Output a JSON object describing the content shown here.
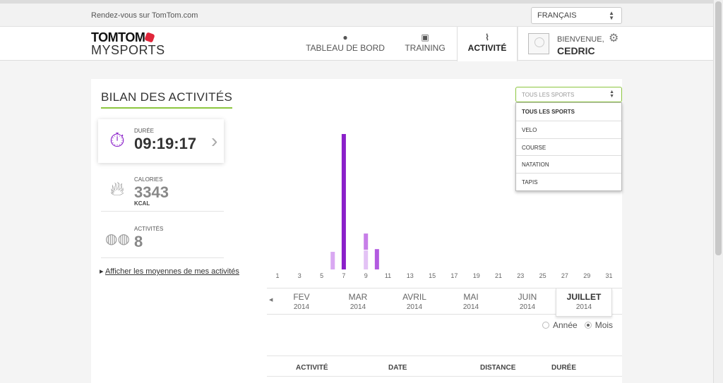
{
  "topbar": {
    "link": "Rendez-vous sur TomTom.com",
    "language": "FRANÇAIS"
  },
  "logo": {
    "line1": "TOMTOM",
    "line2": "MYSPORTS"
  },
  "nav": {
    "dashboard": "TABLEAU DE BORD",
    "training": "TRAINING",
    "activity": "ACTIVITÉ"
  },
  "user": {
    "welcome": "BIENVENUE,",
    "name": "CEDRIC"
  },
  "page": {
    "title": "BILAN DES ACTIVITÉS"
  },
  "stats": {
    "duration": {
      "label": "DURÉE",
      "value": "09:19:17"
    },
    "calories": {
      "label": "CALORIES",
      "value": "3343",
      "unit": "KCAL"
    },
    "activities": {
      "label": "ACTIVITÉS",
      "value": "8"
    }
  },
  "averages_link": "Afficher les moyennes de mes activités",
  "sport_filter": {
    "selected": "TOUS LES SPORTS",
    "options": [
      "TOUS LES SPORTS",
      "VELO",
      "COURSE",
      "NATATION",
      "TAPIS"
    ]
  },
  "chart_data": {
    "type": "bar",
    "x_tick_labels": [
      "1",
      "3",
      "5",
      "7",
      "9",
      "11",
      "13",
      "15",
      "17",
      "19",
      "21",
      "23",
      "25",
      "27",
      "29",
      "31"
    ],
    "bars": [
      {
        "day": 6,
        "value": 0.13,
        "color": "#d9a8f2"
      },
      {
        "day": 7,
        "value": 1.0,
        "color": "#8a1fc9"
      },
      {
        "day": 9,
        "value": 0.14,
        "color": "#e3c2f5"
      },
      {
        "day": 9,
        "value": 0.12,
        "color": "#c77ee8",
        "stacked": true
      },
      {
        "day": 10,
        "value": 0.15,
        "color": "#b25ae0"
      }
    ]
  },
  "months": [
    {
      "month": "FEV",
      "year": "2014"
    },
    {
      "month": "MAR",
      "year": "2014"
    },
    {
      "month": "AVRIL",
      "year": "2014"
    },
    {
      "month": "MAI",
      "year": "2014"
    },
    {
      "month": "JUIN",
      "year": "2014"
    },
    {
      "month": "JUILLET",
      "year": "2014",
      "selected": true
    }
  ],
  "period": {
    "year_label": "Année",
    "month_label": "Mois",
    "selected": "Mois"
  },
  "table": {
    "headers": [
      "ACTIVITÉ",
      "DATE",
      "DISTANCE",
      "DURÉE"
    ]
  }
}
